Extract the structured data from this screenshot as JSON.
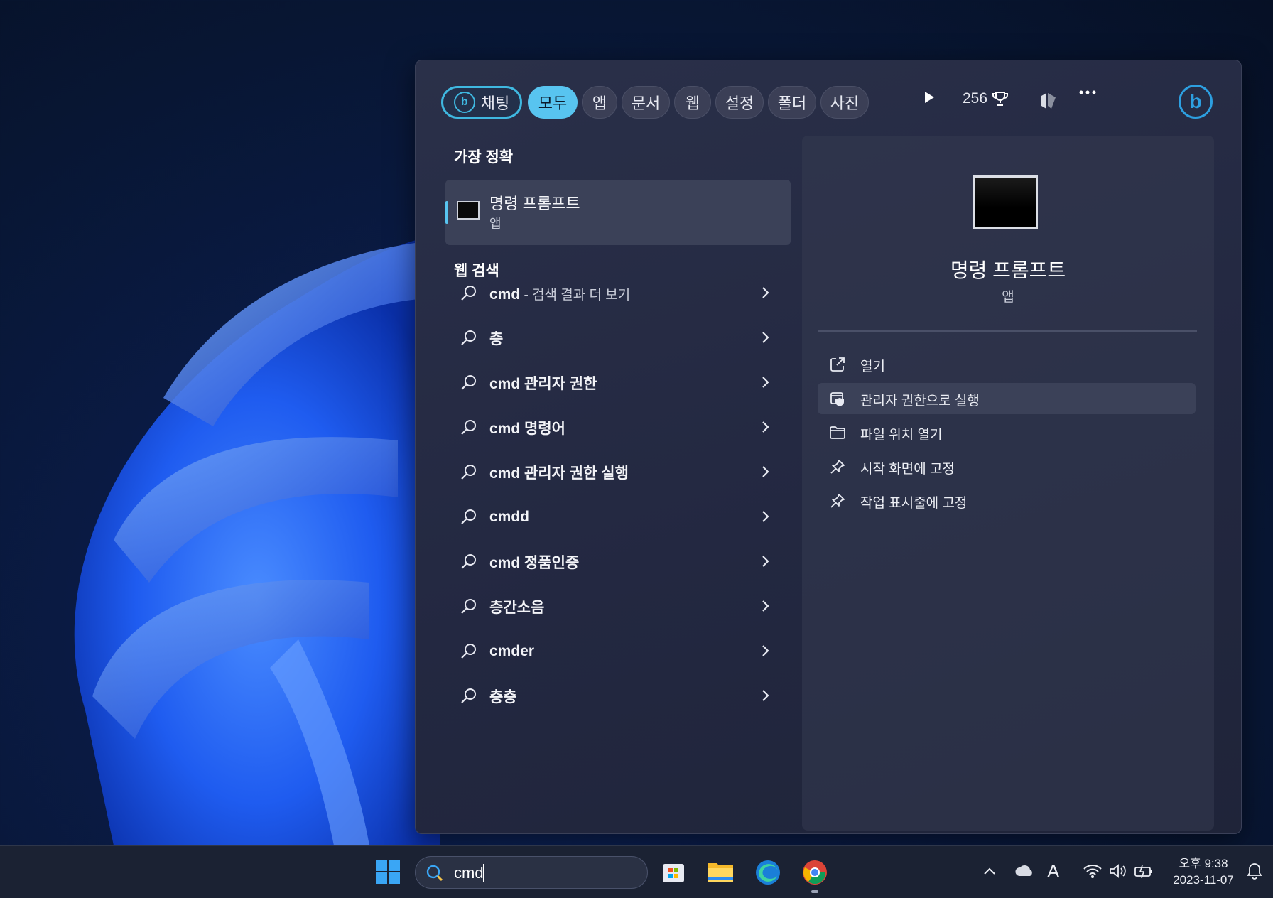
{
  "topbar": {
    "chips": [
      {
        "label": "채팅"
      },
      {
        "label": "모두"
      },
      {
        "label": "앱"
      },
      {
        "label": "문서"
      },
      {
        "label": "웹"
      },
      {
        "label": "설정"
      },
      {
        "label": "폴더"
      },
      {
        "label": "사진"
      }
    ],
    "active_chip": "모두",
    "points": "256"
  },
  "best_match": {
    "heading": "가장 정확",
    "title": "명령 프롬프트",
    "subtitle": "앱"
  },
  "web_search": {
    "heading": "웹 검색",
    "items": [
      {
        "bold": "cmd",
        "rest": " - 검색 결과 더 보기"
      },
      {
        "bold": "층",
        "rest": ""
      },
      {
        "bold": "cmd 관리자 권한",
        "rest": ""
      },
      {
        "bold": "cmd 명령어",
        "rest": ""
      },
      {
        "bold": "cmd 관리자 권한 실행",
        "rest": ""
      },
      {
        "bold": "cmdd",
        "rest": ""
      },
      {
        "bold": "cmd 정품인증",
        "rest": ""
      },
      {
        "bold": "층간소음",
        "rest": ""
      },
      {
        "bold": "cmder",
        "rest": ""
      },
      {
        "bold": "층층",
        "rest": ""
      }
    ]
  },
  "detail": {
    "title": "명령 프롬프트",
    "subtitle": "앱",
    "actions": [
      {
        "label": "열기",
        "icon": "open-external-icon"
      },
      {
        "label": "관리자 권한으로 실행",
        "icon": "admin-shield-icon"
      },
      {
        "label": "파일 위치 열기",
        "icon": "folder-icon"
      },
      {
        "label": "시작 화면에 고정",
        "icon": "pin-icon"
      },
      {
        "label": "작업 표시줄에 고정",
        "icon": "pin-icon"
      }
    ]
  },
  "taskbar": {
    "search_value": "cmd",
    "time": "오후 9:38",
    "date": "2023-11-07"
  },
  "colors": {
    "accent": "#58c4f0",
    "bing": "#2d9fe0",
    "panel": "#252a43"
  }
}
